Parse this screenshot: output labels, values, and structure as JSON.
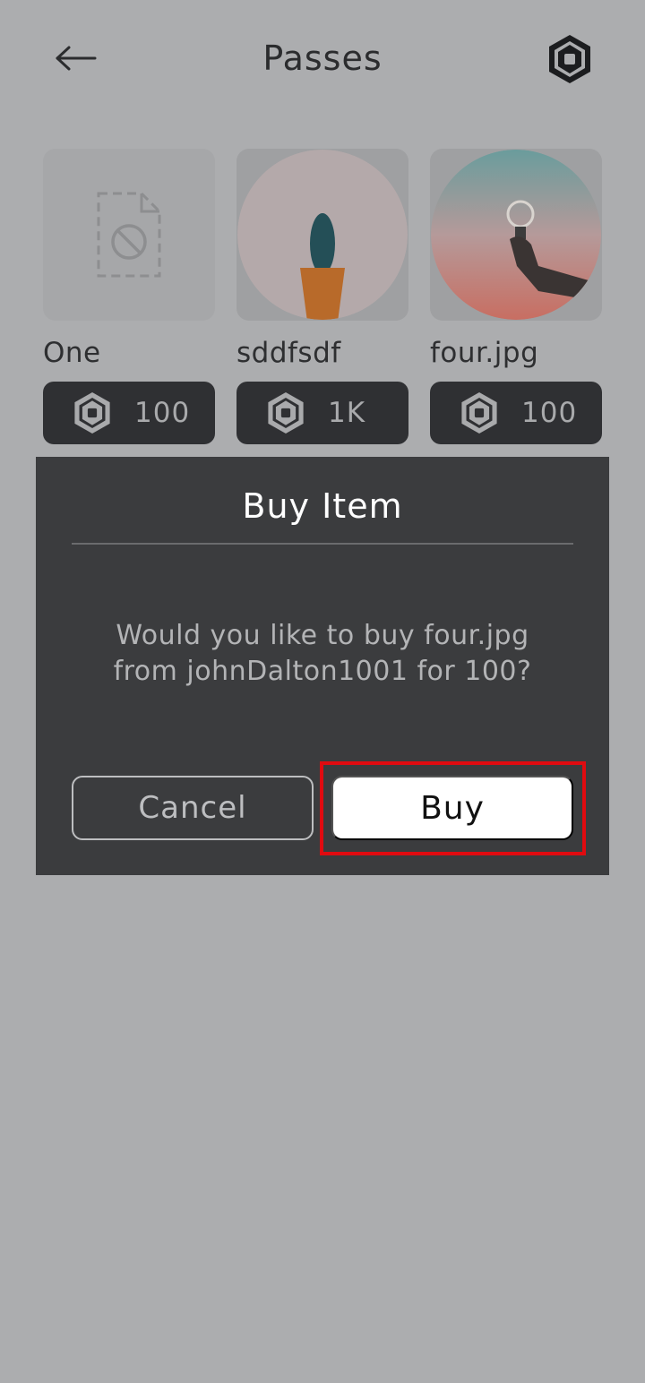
{
  "header": {
    "title": "Passes",
    "back_icon": "back-arrow-icon",
    "robux_icon": "robux-icon"
  },
  "passes": [
    {
      "name": "One",
      "price": "100",
      "thumbnail": "missing-image-icon"
    },
    {
      "name": "sddfsdf",
      "price": "1K",
      "thumbnail": "cactus-photo"
    },
    {
      "name": "four.jpg",
      "price": "100",
      "thumbnail": "lightbulb-hand-photo"
    }
  ],
  "dialog": {
    "title": "Buy Item",
    "message_line1": "Would you like to buy four.jpg",
    "message_line2": "from johnDalton1001 for 100?",
    "cancel_label": "Cancel",
    "buy_label": "Buy"
  },
  "colors": {
    "overlay_bg": "#acadaf",
    "dialog_bg": "#3b3c3e",
    "price_bg": "#2f3033",
    "highlight": "#e00b10"
  }
}
